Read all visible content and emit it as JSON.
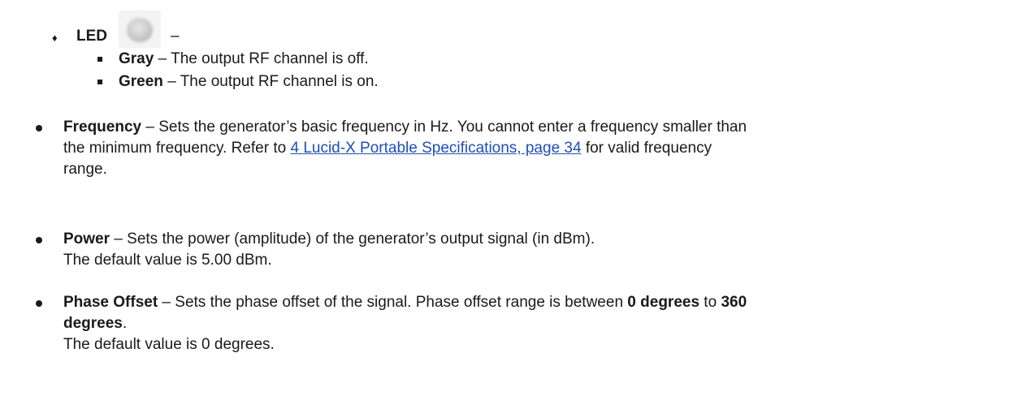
{
  "led": {
    "bullet_glyph": "♦",
    "title": "LED",
    "dash": "–",
    "items": [
      {
        "term": "Gray",
        "text": " – The output RF channel is off."
      },
      {
        "term": "Green",
        "text": " – The output RF channel is on."
      }
    ],
    "icon": "led-gray-icon",
    "icon_color": "#c8c8c8"
  },
  "frequency": {
    "term": "Frequency",
    "line1": " – Sets the generator’s basic frequency in Hz. You cannot enter a frequency smaller than",
    "line2_pre": "the minimum frequency. Refer to ",
    "link": "4 Lucid-X Portable Specifications, page 34",
    "line2_post": " for valid frequency",
    "line3": "range."
  },
  "power": {
    "term": "Power",
    "line1": " – Sets the power (amplitude) of the generator’s output signal (in dBm).",
    "line2": "The default value is 5.00 dBm."
  },
  "phase": {
    "term": "Phase Offset",
    "line1_a": " – Sets the phase offset of the signal. Phase offset range is between ",
    "bold1": "0 degrees",
    "line1_b": " to ",
    "bold2": "360",
    "bold3": "degrees",
    "line2_post": ".",
    "line3": "The default value is 0 degrees."
  },
  "colors": {
    "text": "#1a1a1a",
    "link": "#1f4fb4"
  }
}
